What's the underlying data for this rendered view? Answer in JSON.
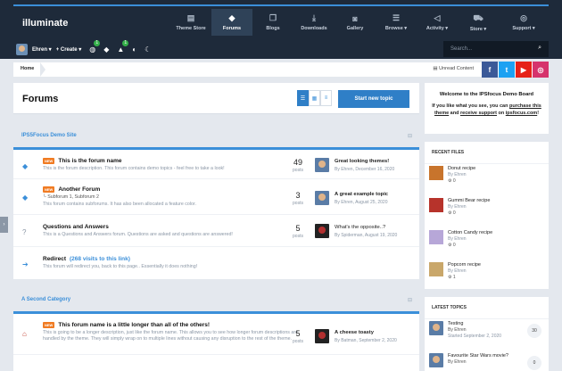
{
  "header": {
    "logo": "illuminate",
    "nav": [
      {
        "label": "Theme Store",
        "icon": "document-icon",
        "glyph": "▤"
      },
      {
        "label": "Forums",
        "icon": "chat-icon",
        "glyph": "◆",
        "active": true
      },
      {
        "label": "Blogs",
        "icon": "book-icon",
        "glyph": "❐"
      },
      {
        "label": "Downloads",
        "icon": "download-icon",
        "glyph": "⤓"
      },
      {
        "label": "Gallery",
        "icon": "camera-icon",
        "glyph": "◙"
      },
      {
        "label": "Browse ▾",
        "icon": "list-icon",
        "glyph": "☰"
      },
      {
        "label": "Activity ▾",
        "icon": "megaphone-icon",
        "glyph": "◁"
      },
      {
        "label": "Store ▾",
        "icon": "cart-icon",
        "glyph": "⛟"
      },
      {
        "label": "Support ▾",
        "icon": "lifebuoy-icon",
        "glyph": "◎"
      }
    ]
  },
  "userbar": {
    "username": "Ehren ▾",
    "create": "+ Create ▾",
    "notifications_badge": "1",
    "warnings_badge": "1",
    "search_placeholder": "Search..."
  },
  "breadcrumb": {
    "home": "Home",
    "unread": "Unread Content"
  },
  "page": {
    "title": "Forums",
    "new_topic": "Start new topic"
  },
  "categories": [
    {
      "title": "IPS5Focus Demo Site",
      "forums": [
        {
          "title": "This is the forum name",
          "is_new": true,
          "desc": "This is the forum description. This forum contains demo topics - feel free to take a look!",
          "count": "49",
          "posts_label": "posts",
          "last_title": "Great looking themes!",
          "last_meta": "By Ehren, December 16, 2020"
        },
        {
          "title": "Another Forum",
          "is_new": true,
          "subforums": "└ Subforum 1,  Subforum 2",
          "desc": "This forum contains subforums. It has also been allocated a feature color.",
          "count": "3",
          "posts_label": "posts",
          "last_title": "A great example topic",
          "last_meta": "By Ehren, August 25, 2020"
        },
        {
          "title": "Questions and Answers",
          "desc": "This is a Questions and Answers forum. Questions are asked and questions are answered!",
          "count": "5",
          "posts_label": "posts",
          "last_title": "What's the opposite..?",
          "last_meta": "By Spiderman, August 19, 2020"
        },
        {
          "title": "Redirect",
          "redirects": "(268 visits to this link)",
          "desc": "This forum will redirect you, back to this page.. Essentially it does nothing!"
        }
      ]
    },
    {
      "title": "A Second Category",
      "forums": [
        {
          "title": "This forum name is a little longer than all of the others!",
          "is_new": true,
          "desc": "This is going to be a longer description, just like the forum name. This allows you to see how longer forum descriptions are handled by the theme. They will simply wrap on to multiple lines without causing any disruption to the rest of the theme.",
          "count": "5",
          "posts_label": "posts",
          "last_title": "A cheese toasty",
          "last_meta": "By Batman, September 2, 2020"
        }
      ]
    }
  ],
  "sidebar": {
    "welcome_title": "Welcome to the IPSfocus Demo Board",
    "welcome_p1": "If you like what you see, you can ",
    "welcome_link1": "purchase this theme",
    "welcome_p2": " and ",
    "welcome_link2": "receive support",
    "welcome_p3": " on ",
    "welcome_link3": "ipsfocus.com",
    "welcome_p4": "!",
    "recent_files_title": "RECENT FILES",
    "recent_files": [
      {
        "title": "Donut recipe",
        "by": "By Ehren",
        "count": "⚙ 0",
        "color": "#c8742c"
      },
      {
        "title": "Gummi Bear recipe",
        "by": "By Ehren",
        "count": "⚙ 0",
        "color": "#b7332b"
      },
      {
        "title": "Cotton Candy recipe",
        "by": "By Ehren",
        "count": "⚙ 0",
        "color": "#b7a7d8"
      },
      {
        "title": "Popcorn recipe",
        "by": "By Ehren",
        "count": "⚙ 1",
        "color": "#c9a76a"
      }
    ],
    "latest_topics_title": "LATEST TOPICS",
    "latest_topics": [
      {
        "title": "Testing",
        "by": "By Ehren",
        "date": "Started September 2, 2020",
        "count": "30"
      },
      {
        "title": "Favourite Star Wars movie?",
        "by": "By Ehren",
        "date": "",
        "count": "0"
      }
    ]
  }
}
